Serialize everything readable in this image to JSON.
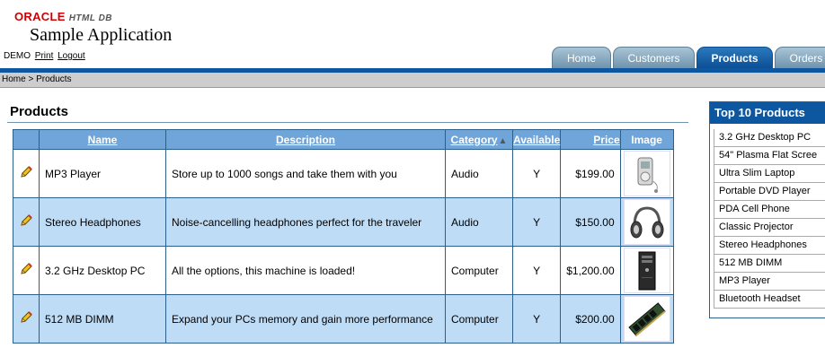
{
  "header": {
    "logo_oracle": "ORACLE",
    "logo_product": "HTML DB",
    "app_name": "Sample Application"
  },
  "user": {
    "name": "DEMO",
    "print": "Print",
    "logout": "Logout"
  },
  "tabs": [
    {
      "label": "Home"
    },
    {
      "label": "Customers"
    },
    {
      "label": "Products"
    },
    {
      "label": "Orders"
    }
  ],
  "breadcrumb": "Home > Products",
  "region_title": "Products",
  "table": {
    "headers": {
      "name": "Name",
      "description": "Description",
      "category": "Category",
      "available": "Available",
      "price": "Price",
      "image": "Image"
    },
    "sort_indicator": "▲",
    "rows": [
      {
        "name": "MP3 Player",
        "description": "Store up to 1000 songs and take them with you",
        "category": "Audio",
        "available": "Y",
        "price": "$199.00",
        "image": "mp3-player-image"
      },
      {
        "name": "Stereo Headphones",
        "description": "Noise-cancelling headphones perfect for the traveler",
        "category": "Audio",
        "available": "Y",
        "price": "$150.00",
        "image": "headphones-image"
      },
      {
        "name": "3.2 GHz Desktop PC",
        "description": "All the options, this machine is loaded!",
        "category": "Computer",
        "available": "Y",
        "price": "$1,200.00",
        "image": "desktop-pc-image"
      },
      {
        "name": "512 MB DIMM",
        "description": "Expand your PCs memory and gain more performance",
        "category": "Computer",
        "available": "Y",
        "price": "$200.00",
        "image": "memory-module-image"
      }
    ]
  },
  "top10": {
    "title": "Top 10 Products",
    "items": [
      "3.2 GHz Desktop PC",
      "54\" Plasma Flat Scree",
      "Ultra Slim Laptop",
      "Portable DVD Player",
      "PDA Cell Phone",
      "Classic Projector",
      "Stereo Headphones",
      "512 MB DIMM",
      "MP3 Player",
      "Bluetooth Headset"
    ]
  },
  "colors": {
    "tab_active": "#0c57a0",
    "row_alt": "#bfdcf6",
    "header_cell": "#6fa5d8",
    "logo_red": "#d20000"
  }
}
